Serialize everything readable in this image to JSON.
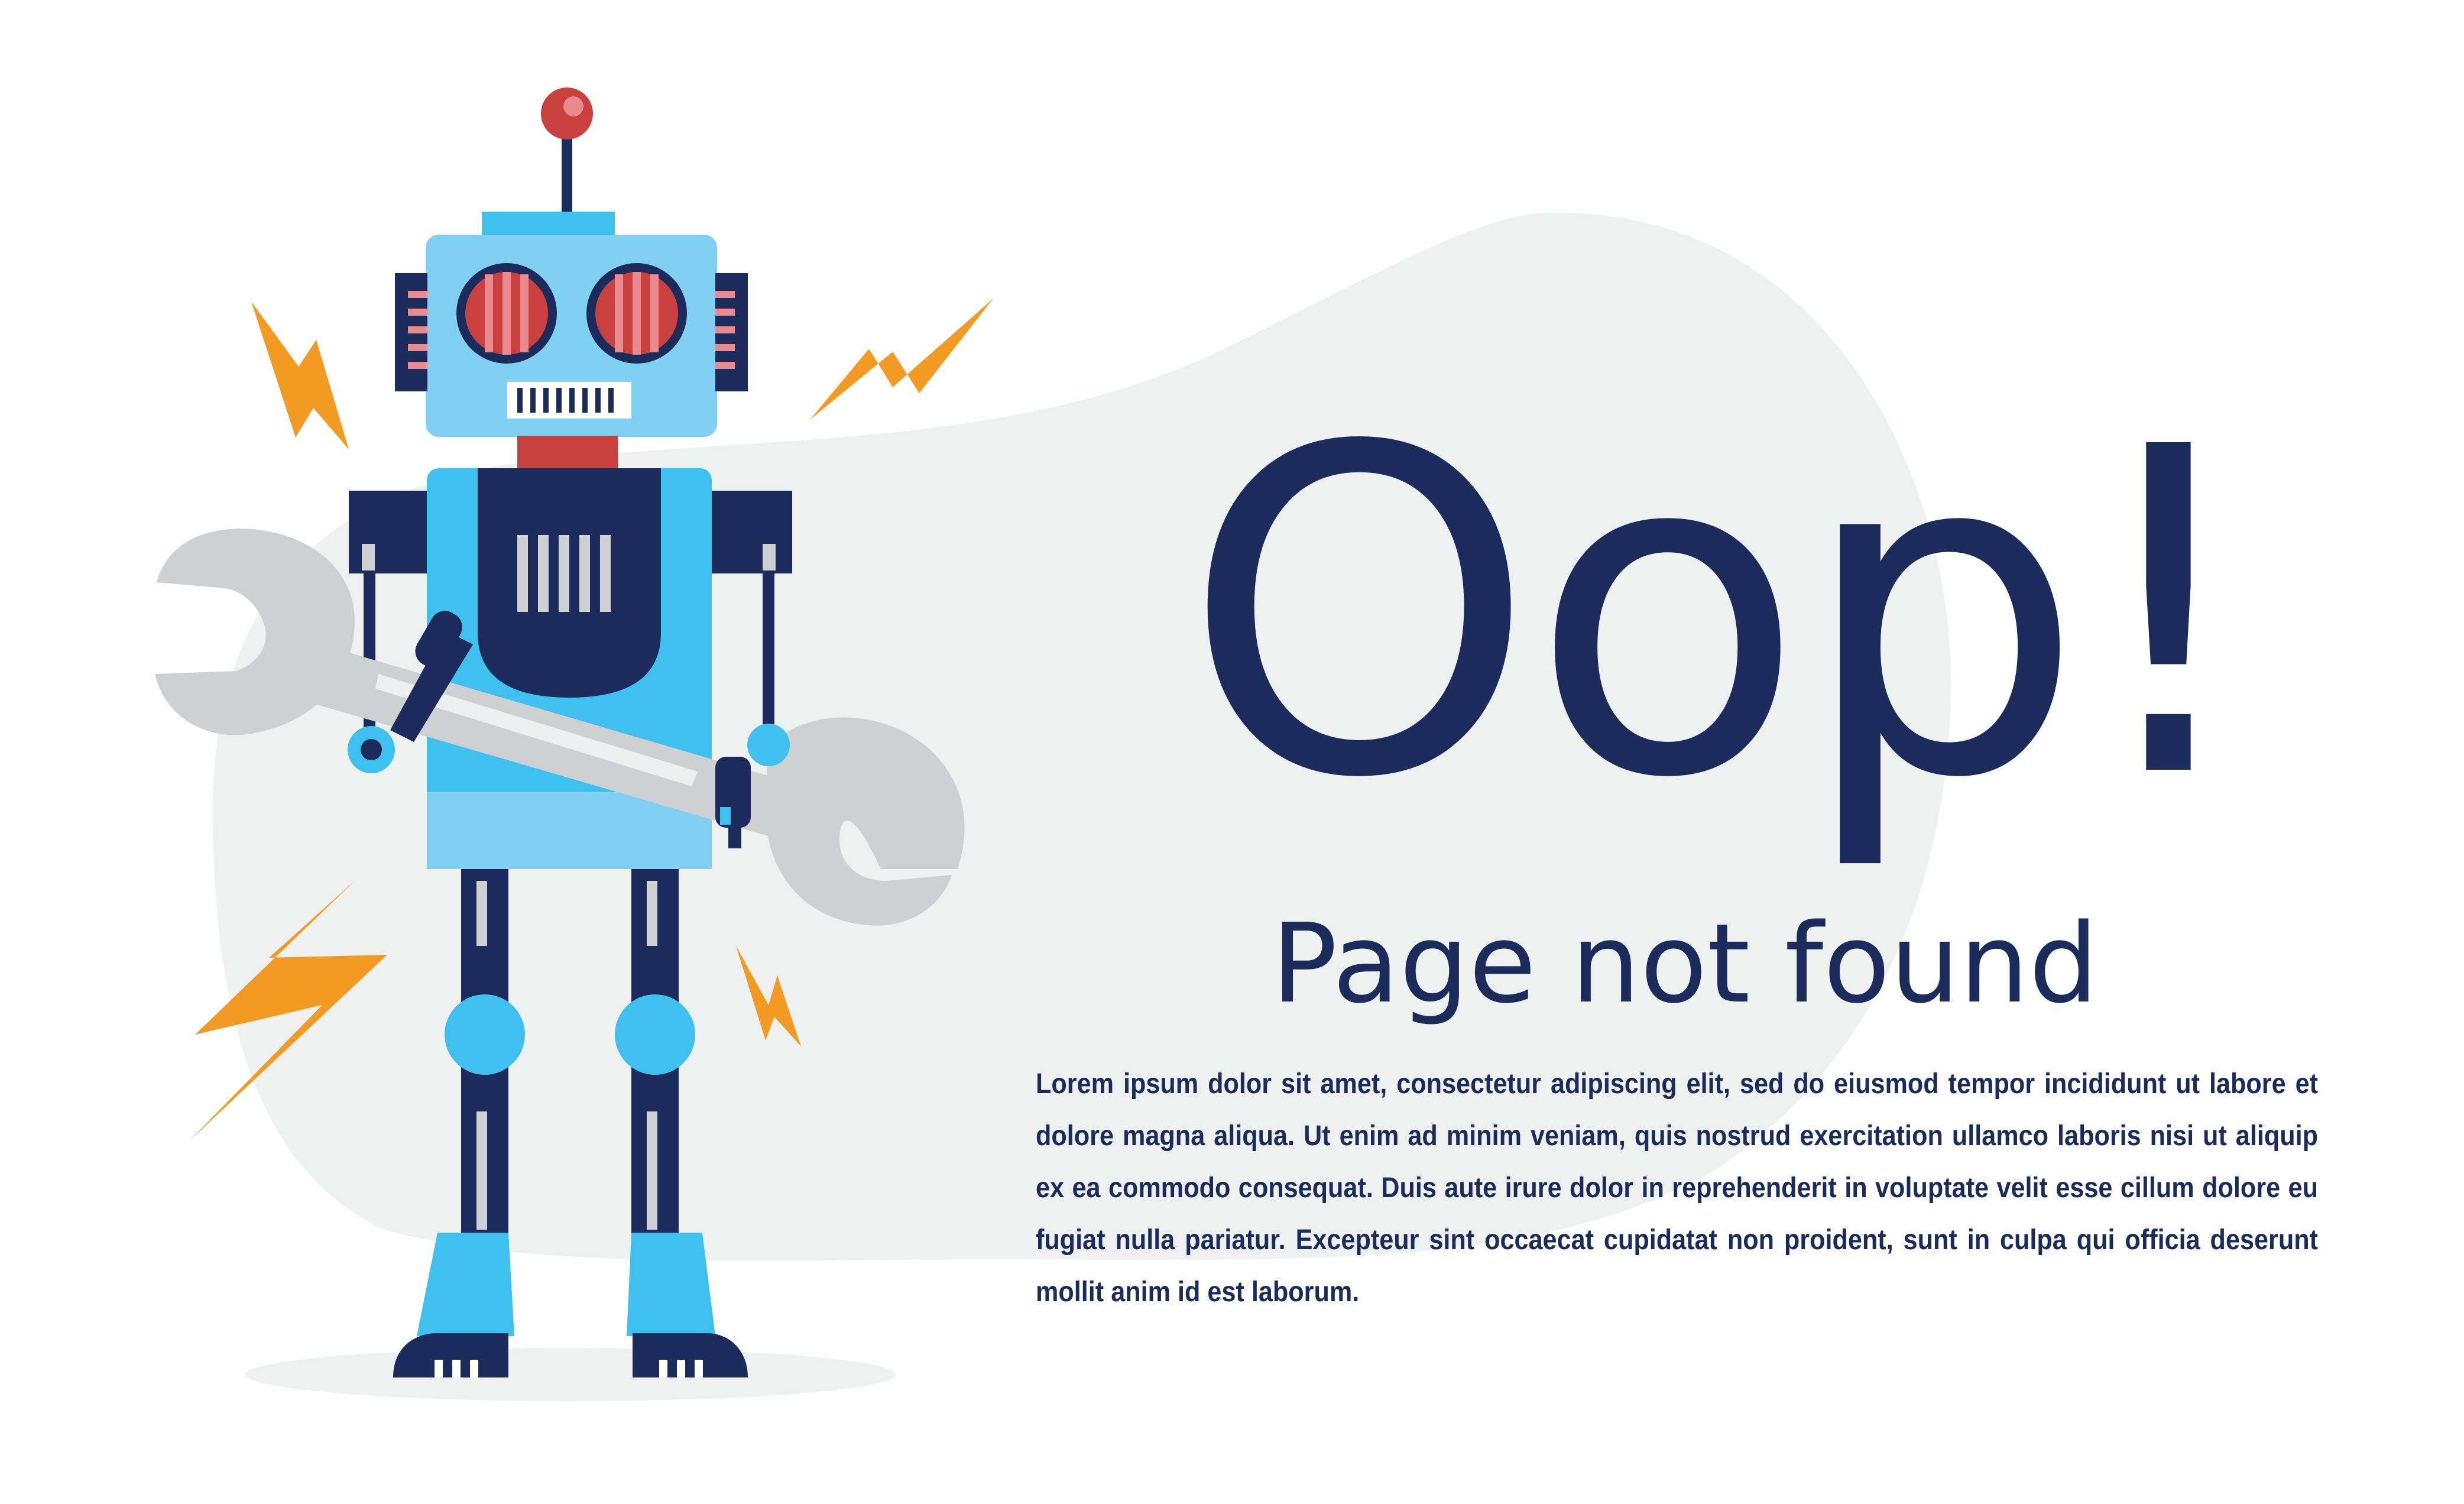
{
  "illustration": {
    "subject": "robot-with-wrench-icon",
    "colors": {
      "navy": "#1a2b5c",
      "light_blue": "#7fd0f2",
      "sky_blue": "#3ec1ee",
      "red": "#c9403f",
      "pink": "#e98a8f",
      "orange": "#f39a22",
      "gray": "#cfd0d2",
      "blob": "#eff1f1"
    }
  },
  "message": {
    "headline": "Oop!",
    "subtitle": "Page not found",
    "body": "Lorem ipsum dolor sit amet, consectetur adipiscing elit, sed do eiusmod tempor incididunt ut labore et dolore magna aliqua. Ut enim ad minim veniam, quis nostrud exercitation ullamco laboris nisi ut aliquip ex ea commodo consequat. Duis aute irure dolor in reprehenderit in voluptate velit esse cillum dolore eu fugiat nulla pariatur. Excepteur sint occaecat cupidatat non proident, sunt in culpa qui officia deserunt mollit anim id est laborum."
  }
}
